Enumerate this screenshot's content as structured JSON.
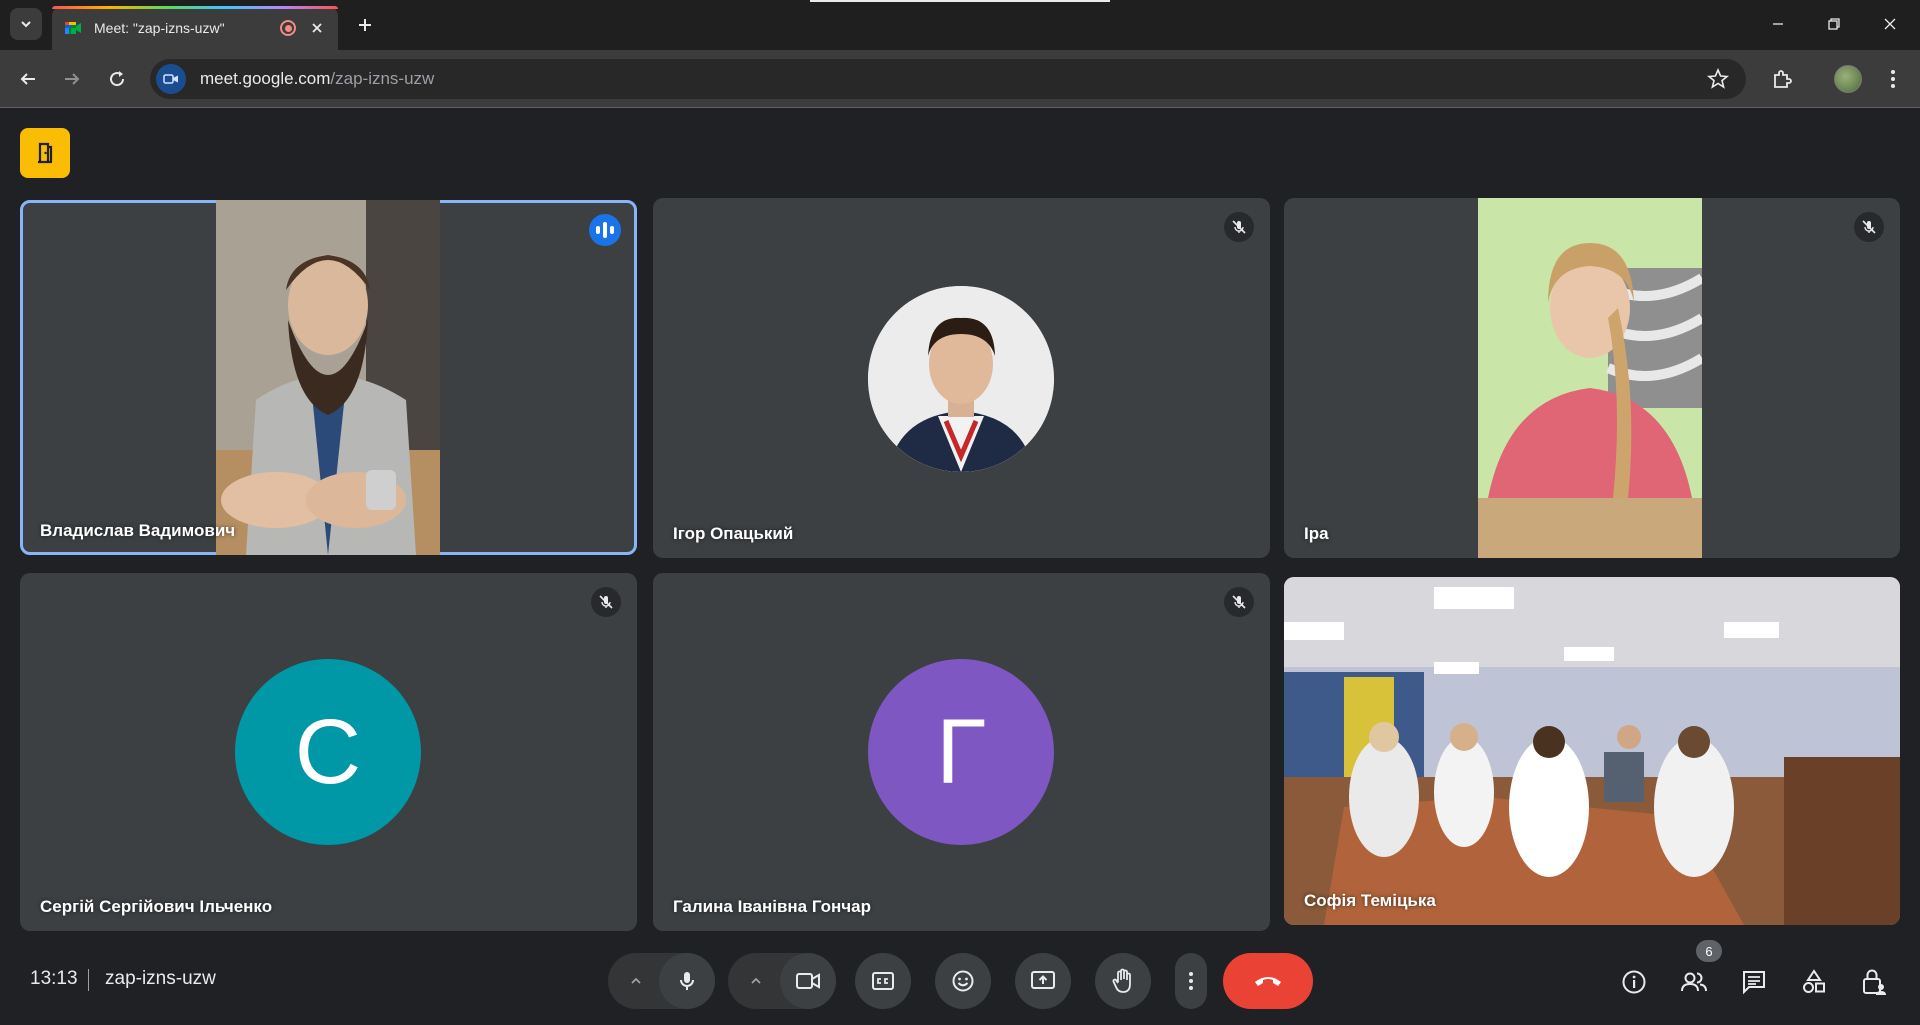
{
  "browser": {
    "tab_title": "Meet: \"zap-izns-uzw\"",
    "url_host": "meet.google.com",
    "url_path": "/zap-izns-uzw"
  },
  "participants": [
    {
      "name": "Владислав Вадимович",
      "state": "speaking"
    },
    {
      "name": "Ігор Опацький",
      "state": "muted"
    },
    {
      "name": "Іра",
      "state": "muted"
    },
    {
      "name": "Сергій Сергійович Ільченко",
      "state": "muted",
      "initial": "С",
      "color": "#0097a7"
    },
    {
      "name": "Галина Іванівна Гончар",
      "state": "muted",
      "initial": "Г",
      "color": "#7e57c2"
    },
    {
      "name": "Софія Теміцька",
      "state": "video"
    }
  ],
  "bottom_bar": {
    "time": "13:13",
    "meeting_code": "zap-izns-uzw",
    "participants_count": "6"
  },
  "colors": {
    "accent_blue": "#8ab4f8",
    "hangup_red": "#ea4335",
    "host_yellow": "#fbbc04"
  }
}
